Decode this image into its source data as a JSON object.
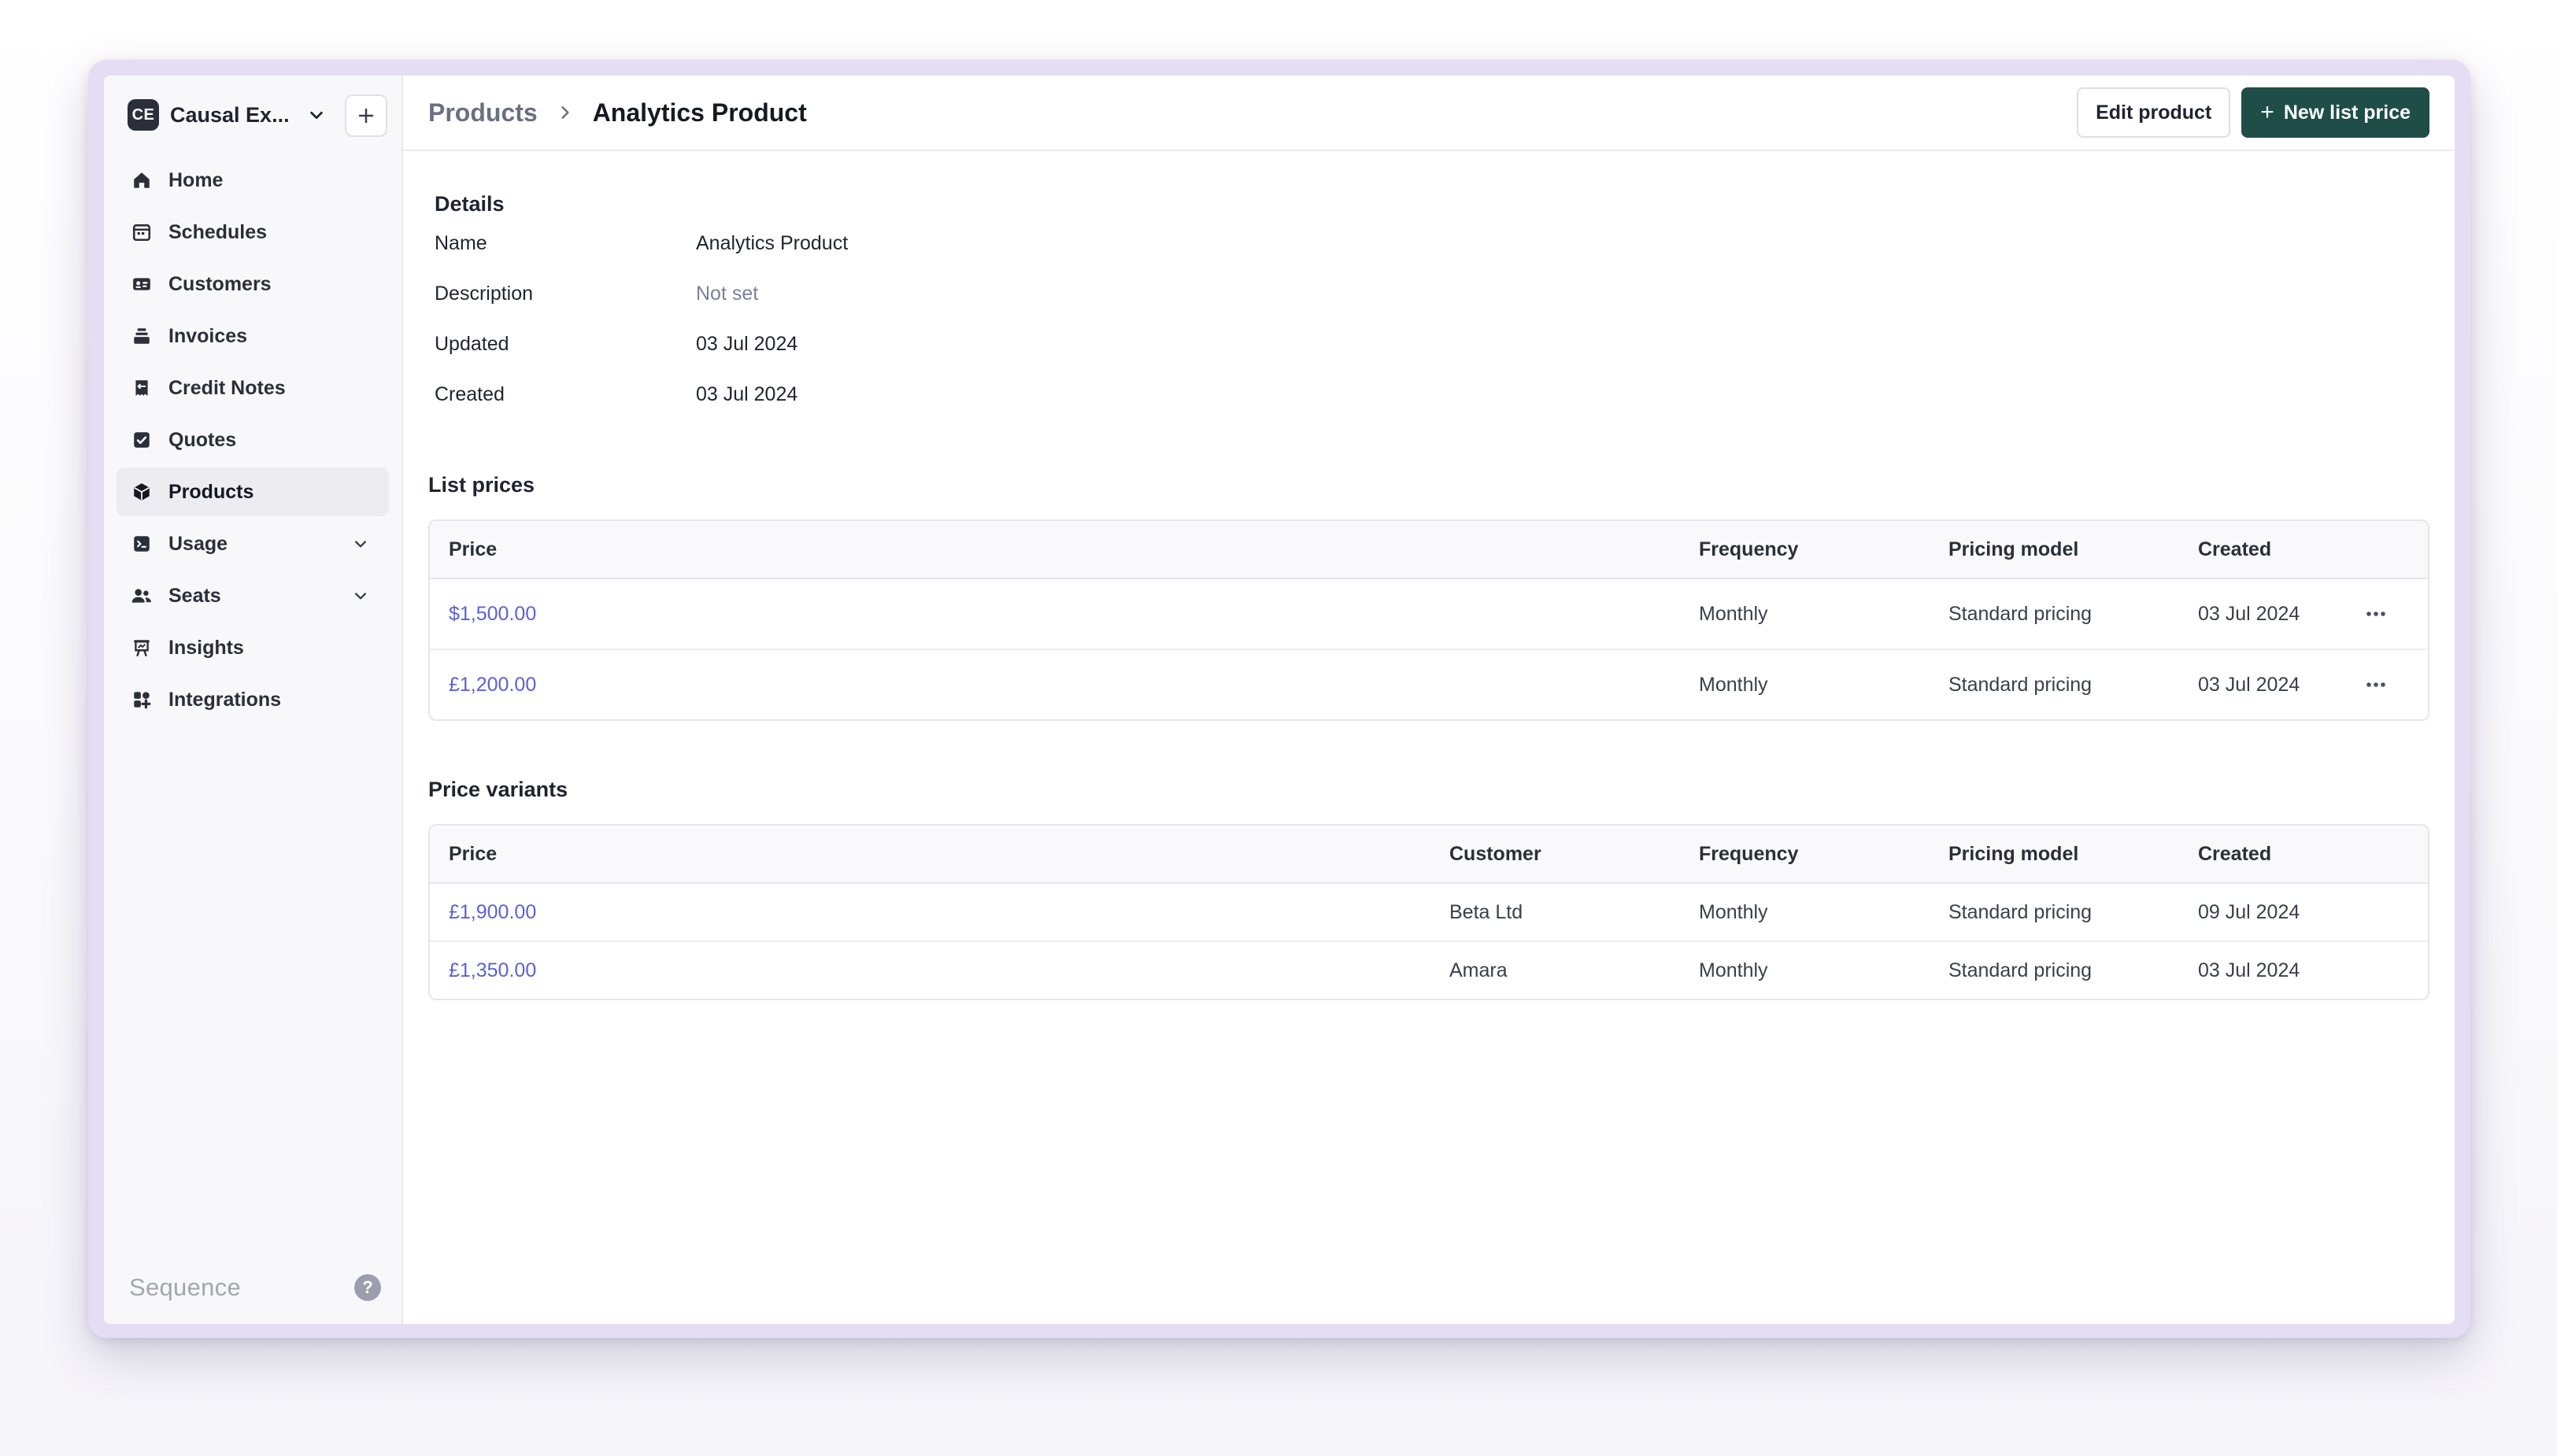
{
  "workspace": {
    "initials": "CE",
    "name": "Causal Ex..."
  },
  "sidebar": {
    "items": [
      {
        "label": "Home",
        "icon": "home-icon"
      },
      {
        "label": "Schedules",
        "icon": "calendar-icon"
      },
      {
        "label": "Customers",
        "icon": "id-card-icon"
      },
      {
        "label": "Invoices",
        "icon": "stack-icon"
      },
      {
        "label": "Credit Notes",
        "icon": "receipt-icon"
      },
      {
        "label": "Quotes",
        "icon": "check-document-icon"
      },
      {
        "label": "Products",
        "icon": "cube-icon",
        "active": true
      },
      {
        "label": "Usage",
        "icon": "terminal-icon",
        "expandable": true
      },
      {
        "label": "Seats",
        "icon": "users-icon",
        "expandable": true
      },
      {
        "label": "Insights",
        "icon": "chart-board-icon"
      },
      {
        "label": "Integrations",
        "icon": "grid-icon"
      }
    ],
    "brand": "Sequence"
  },
  "header": {
    "breadcrumb_parent": "Products",
    "breadcrumb_current": "Analytics Product",
    "edit_label": "Edit product",
    "new_price_label": "New list price"
  },
  "details": {
    "title": "Details",
    "rows": [
      {
        "label": "Name",
        "value": "Analytics Product"
      },
      {
        "label": "Description",
        "value": "Not set"
      },
      {
        "label": "Updated",
        "value": "03 Jul 2024"
      },
      {
        "label": "Created",
        "value": "03 Jul 2024"
      }
    ]
  },
  "list_prices": {
    "title": "List prices",
    "columns": [
      "Price",
      "Frequency",
      "Pricing model",
      "Created"
    ],
    "rows": [
      {
        "price": "$1,500.00",
        "frequency": "Monthly",
        "model": "Standard pricing",
        "created": "03 Jul 2024"
      },
      {
        "price": "£1,200.00",
        "frequency": "Monthly",
        "model": "Standard pricing",
        "created": "03 Jul 2024"
      }
    ]
  },
  "price_variants": {
    "title": "Price variants",
    "columns": [
      "Price",
      "Customer",
      "Frequency",
      "Pricing model",
      "Created"
    ],
    "rows": [
      {
        "price": "£1,900.00",
        "customer": "Beta Ltd",
        "frequency": "Monthly",
        "model": "Standard pricing",
        "created": "09 Jul 2024"
      },
      {
        "price": "£1,350.00",
        "customer": "Amara",
        "frequency": "Monthly",
        "model": "Standard pricing",
        "created": "03 Jul 2024"
      }
    ]
  },
  "colors": {
    "accent": "#1f4d47",
    "link": "#5b62d4",
    "frame": "#e4ddf4"
  }
}
